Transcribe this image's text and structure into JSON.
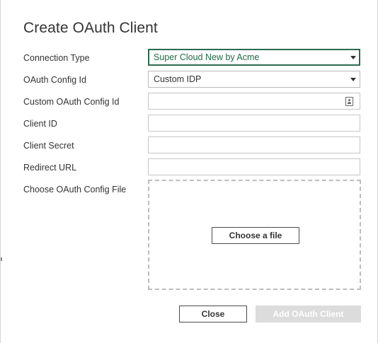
{
  "dialog": {
    "title": "Create OAuth Client"
  },
  "form": {
    "connection_type": {
      "label": "Connection Type",
      "value": "Super Cloud New by Acme"
    },
    "oauth_config_id": {
      "label": "OAuth Config Id",
      "value": "Custom IDP"
    },
    "custom_oauth_config_id": {
      "label": "Custom OAuth Config Id",
      "value": "",
      "icon": "contact-card-icon"
    },
    "client_id": {
      "label": "Client ID",
      "value": ""
    },
    "client_secret": {
      "label": "Client Secret",
      "value": ""
    },
    "redirect_url": {
      "label": "Redirect URL",
      "value": ""
    },
    "oauth_config_file": {
      "label": "Choose OAuth Config File",
      "button_label": "Choose a file"
    }
  },
  "footer": {
    "close_label": "Close",
    "submit_label": "Add OAuth Client"
  },
  "colors": {
    "accent": "#2b6b4f",
    "accent_text": "#1f6b45",
    "disabled_button": "#dcdcdc"
  }
}
